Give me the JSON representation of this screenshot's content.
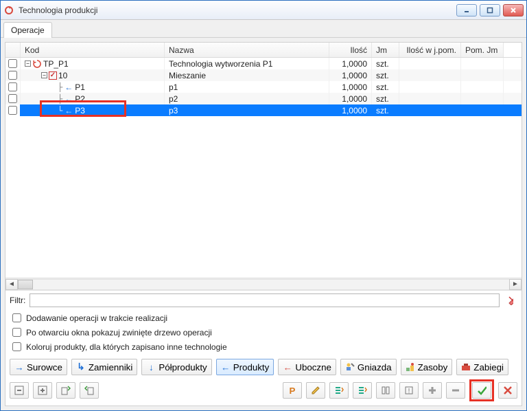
{
  "window": {
    "title": "Technologia produkcji"
  },
  "tabs": {
    "operacje": "Operacje"
  },
  "columns": {
    "kod": "Kod",
    "nazwa": "Nazwa",
    "ilosc": "Ilość",
    "jm": "Jm",
    "ilosc_w_jpom": "Ilość w j.pom.",
    "pom_jm": "Pom. Jm"
  },
  "rows": [
    {
      "kod": "TP_P1",
      "nazwa": "Technologia wytworzenia P1",
      "ilosc": "1,0000",
      "jm": "szt.",
      "icon": "refresh",
      "depth": 0,
      "expandable": true,
      "selected": false,
      "alt": false
    },
    {
      "kod": "10",
      "nazwa": "Mieszanie",
      "ilosc": "1,0000",
      "jm": "szt.",
      "icon": "redcheck",
      "depth": 1,
      "expandable": true,
      "selected": false,
      "alt": true
    },
    {
      "kod": "P1",
      "nazwa": "p1",
      "ilosc": "1,0000",
      "jm": "szt.",
      "icon": "arrow",
      "depth": 2,
      "expandable": false,
      "selected": false,
      "alt": false
    },
    {
      "kod": "P2",
      "nazwa": "p2",
      "ilosc": "1,0000",
      "jm": "szt.",
      "icon": "arrow",
      "depth": 2,
      "expandable": false,
      "selected": false,
      "alt": true
    },
    {
      "kod": "P3",
      "nazwa": "p3",
      "ilosc": "1,0000",
      "jm": "szt.",
      "icon": "arrow",
      "depth": 2,
      "expandable": false,
      "selected": true,
      "alt": false
    }
  ],
  "filter": {
    "label": "Filtr:",
    "value": ""
  },
  "options": {
    "opt1": "Dodawanie operacji w trakcie realizacji",
    "opt2": "Po otwarciu okna pokazuj zwinięte drzewo operacji",
    "opt3": "Koloruj produkty, dla których zapisano inne technologie"
  },
  "toolbar_labels": {
    "surowce": "Surowce",
    "zamienniki": "Zamienniki",
    "polprodukty": "Półprodukty",
    "produkty": "Produkty",
    "uboczne": "Uboczne",
    "gniazda": "Gniazda",
    "zasoby": "Zasoby",
    "zabiegi": "Zabiegi"
  }
}
